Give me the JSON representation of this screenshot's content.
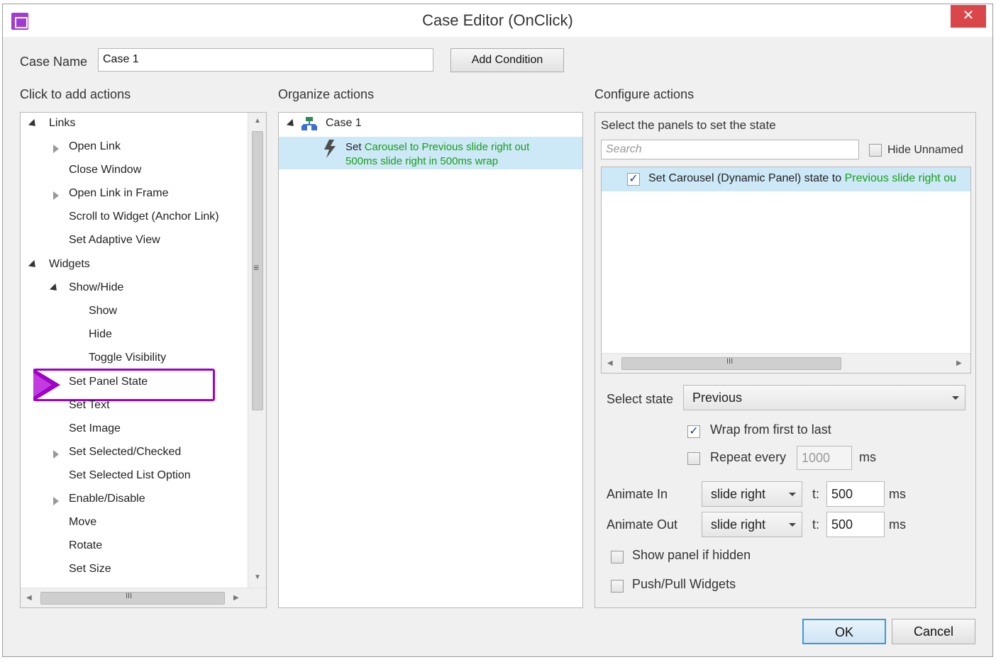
{
  "window": {
    "title": "Case Editor (OnClick)",
    "close_glyph": "✕",
    "app_icon": "axure-rp-icon"
  },
  "case": {
    "name_label": "Case Name",
    "name_value": "Case 1",
    "add_condition": "Add Condition"
  },
  "left": {
    "heading": "Click to add actions",
    "links_group": "Links",
    "links": [
      "Open Link",
      "Close Window",
      "Open Link in Frame",
      "Scroll to Widget (Anchor Link)",
      "Set Adaptive View"
    ],
    "widgets_group": "Widgets",
    "showhide_group": "Show/Hide",
    "showhide_items": [
      "Show",
      "Hide",
      "Toggle Visibility"
    ],
    "widget_items": [
      "Set Panel State",
      "Set Text",
      "Set Image",
      "Set Selected/Checked",
      "Set Selected List Option",
      "Enable/Disable",
      "Move",
      "Rotate",
      "Set Size"
    ],
    "scroll_grip": "≡",
    "hscroll_grip": "III",
    "highlight_color": "#a000c8"
  },
  "middle": {
    "heading": "Organize actions",
    "case_label": "Case 1",
    "action_set": "Set",
    "action_green_1": "Carousel to Previous slide right out",
    "action_green_2": "500ms slide right in 500ms wrap"
  },
  "right": {
    "heading": "Configure actions",
    "panels_heading": "Select the panels to set the state",
    "search_placeholder": "Search",
    "hide_unnamed": "Hide Unnamed",
    "panel_row_text": "Set Carousel (Dynamic Panel) state to",
    "panel_row_green": "Previous slide right ou",
    "hscroll_grip": "III",
    "select_state_label": "Select state",
    "select_state_value": "Previous",
    "wrap_label": "Wrap from first to last",
    "wrap_checked": true,
    "repeat_label": "Repeat every",
    "repeat_value": "1000",
    "repeat_unit": "ms",
    "animate_in_label": "Animate In",
    "animate_in_value": "slide right",
    "animate_in_t": "t:",
    "animate_in_ms": "500",
    "animate_in_unit": "ms",
    "animate_out_label": "Animate Out",
    "animate_out_value": "slide right",
    "animate_out_t": "t:",
    "animate_out_ms": "500",
    "animate_out_unit": "ms",
    "show_if_hidden": "Show panel if hidden",
    "push_pull": "Push/Pull Widgets"
  },
  "footer": {
    "ok": "OK",
    "cancel": "Cancel"
  },
  "colors": {
    "selection": "#cde8f7",
    "green_text": "#16a016",
    "close_red": "#d9474a"
  }
}
